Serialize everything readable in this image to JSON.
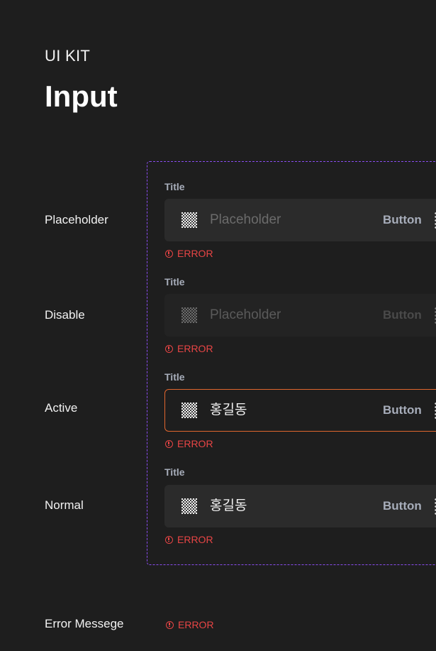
{
  "header": {
    "kit_label": "UI KIT",
    "title": "Input"
  },
  "rows": [
    {
      "label": "Placeholder",
      "field_title": "Title",
      "value": "Placeholder",
      "button": "Button",
      "error": "ERROR",
      "state": "placeholder"
    },
    {
      "label": "Disable",
      "field_title": "Title",
      "value": "Placeholder",
      "button": "Button",
      "error": "ERROR",
      "state": "disabled"
    },
    {
      "label": "Active",
      "field_title": "Title",
      "value": "홍길동",
      "button": "Button",
      "error": "ERROR",
      "state": "active"
    },
    {
      "label": "Normal",
      "field_title": "Title",
      "value": "홍길동",
      "button": "Button",
      "error": "ERROR",
      "state": "normal"
    }
  ],
  "error_message": {
    "label": "Error Messege",
    "text": "ERROR"
  },
  "colors": {
    "background": "#1e1e1e",
    "input_bg": "#2b2b2b",
    "active_border": "#e0662e",
    "error": "#e84545",
    "frame_dash": "#8a4cf0"
  },
  "icons": {
    "image_placeholder": "checkerboard-icon",
    "more": "more-vertical-icon",
    "error": "error-circle-icon"
  }
}
